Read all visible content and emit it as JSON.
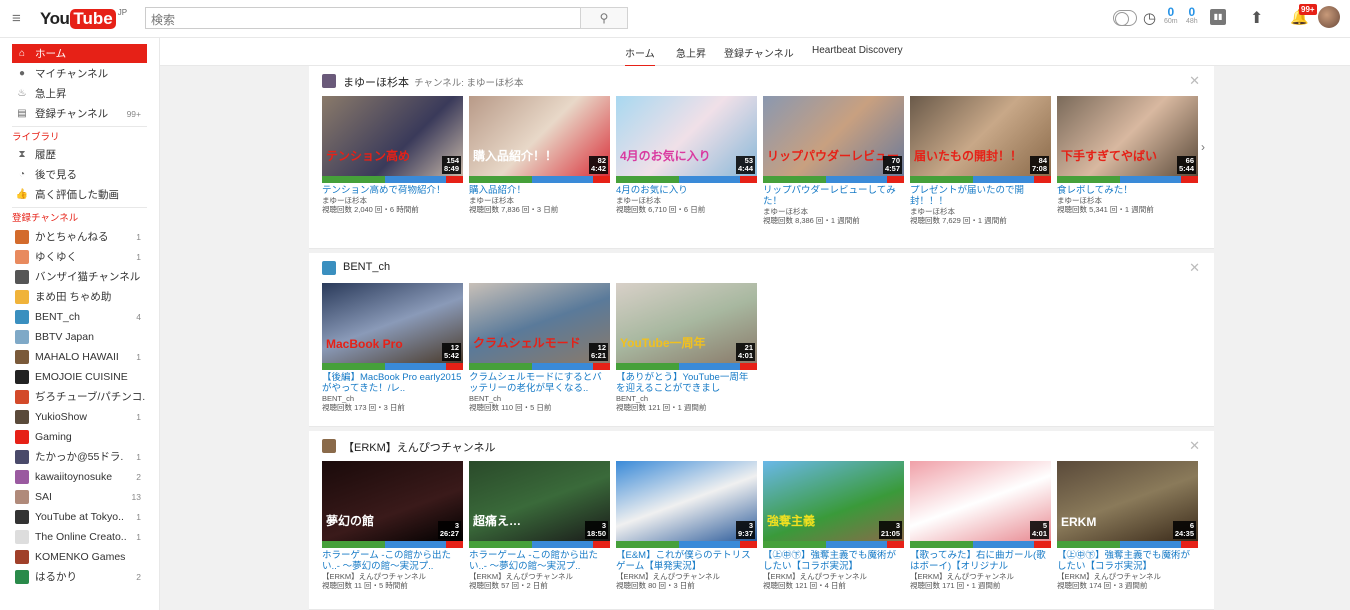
{
  "header": {
    "logo_you": "You",
    "logo_tube": "Tube",
    "logo_region": "JP",
    "search_placeholder": "検索",
    "search_icon": "search-icon",
    "count1": "0",
    "count1_sub": "60m",
    "count2": "0",
    "count2_sub": "48h",
    "notif_badge": "99+"
  },
  "sidebar": {
    "main": [
      {
        "label": "ホーム",
        "icon": "home-icon",
        "active": true
      },
      {
        "label": "マイチャンネル",
        "icon": "person-icon"
      },
      {
        "label": "急上昇",
        "icon": "flame-icon"
      },
      {
        "label": "登録チャンネル",
        "icon": "subscriptions-icon",
        "count": "99+"
      }
    ],
    "library_heading": "ライブラリ",
    "library": [
      {
        "label": "履歴",
        "icon": "hourglass-icon"
      },
      {
        "label": "後で見る",
        "icon": "clock-icon"
      },
      {
        "label": "高く評価した動画",
        "icon": "thumbs-up-icon"
      }
    ],
    "subs_heading": "登録チャンネル",
    "subs": [
      {
        "label": "かとちゃんねる",
        "count": "1",
        "color": "#d36b2c"
      },
      {
        "label": "ゆくゆく",
        "count": "1",
        "color": "#e88a5e"
      },
      {
        "label": "バンザイ猫チャンネル",
        "count": "",
        "color": "#555"
      },
      {
        "label": "まめ田 ちゃめ助",
        "count": "",
        "color": "#f0b33a"
      },
      {
        "label": "BENT_ch",
        "count": "4",
        "color": "#3a8fbf"
      },
      {
        "label": "BBTV Japan",
        "count": "",
        "color": "#7fa9c7"
      },
      {
        "label": "MAHALO HAWAII",
        "count": "1",
        "color": "#7a5a3a"
      },
      {
        "label": "EMOJOIE CUISINE",
        "count": "",
        "color": "#222"
      },
      {
        "label": "ぢろチューブ/パチンコ.",
        "count": "",
        "color": "#d34a2a"
      },
      {
        "label": "YukioShow",
        "count": "1",
        "color": "#5a4a3a"
      },
      {
        "label": "Gaming",
        "count": "",
        "color": "#e62117"
      },
      {
        "label": "たかっか@55ドラ.",
        "count": "1",
        "color": "#4a4a6a"
      },
      {
        "label": "kawaiitoynosuke",
        "count": "2",
        "color": "#9a5aa0"
      },
      {
        "label": "SAI",
        "count": "13",
        "color": "#b08a7a"
      },
      {
        "label": "YouTube at Tokyo..",
        "count": "1",
        "color": "#333"
      },
      {
        "label": "The Online Creato..",
        "count": "1",
        "color": "#ddd"
      },
      {
        "label": "KOMENKO Games",
        "count": "",
        "color": "#a0402a"
      },
      {
        "label": "はるかり",
        "count": "2",
        "color": "#2a8a4a"
      }
    ]
  },
  "nav": {
    "tabs": [
      "ホーム",
      "急上昇",
      "登録チャンネル",
      "Heartbeat Discovery"
    ]
  },
  "sections": [
    {
      "title": "まゆーほ杉本",
      "sub": "チャンネル: まゆーほ杉本",
      "avatar": "#6a5a7a",
      "videos": [
        {
          "title": "テンション高めで荷物紹介！",
          "channel": "まゆーほ杉本",
          "meta": "視聴回数 2,040 回・6 時間前",
          "count": "154",
          "duration": "8:49",
          "bg": "linear-gradient(135deg,#8a7a6a,#3a3a5a 60%,#c8b8a8)",
          "cap": "テンション高め",
          "capc": "#e62117"
        },
        {
          "title": "購入品紹介！",
          "channel": "まゆーほ杉本",
          "meta": "視聴回数 7,836 回・3 日前",
          "count": "82",
          "duration": "4:42",
          "bg": "linear-gradient(135deg,#b89a88,#e8d8c8 50%,#d9303a)",
          "cap": "購入品紹介！！",
          "capc": "#fff"
        },
        {
          "title": "4月のお気に入り",
          "channel": "まゆーほ杉本",
          "meta": "視聴回数 6,710 回・6 日前",
          "count": "53",
          "duration": "4:44",
          "bg": "linear-gradient(135deg,#a8d8f0,#f0e0e8 50%,#88b8d8)",
          "cap": "4月のお気に入り",
          "capc": "#d93aa0"
        },
        {
          "title": "リップパウダーレビューしてみた！",
          "channel": "まゆーほ杉本",
          "meta": "視聴回数 8,386 回・1 週間前",
          "count": "70",
          "duration": "4:57",
          "bg": "linear-gradient(135deg,#8a98b0,#c8a080 50%,#6a7a9a)",
          "cap": "リップパウダーレビュー",
          "capc": "#e62117"
        },
        {
          "title": "プレゼントが届いたので開封！！！",
          "channel": "まゆーほ杉本",
          "meta": "視聴回数 7,629 回・1 週間前",
          "count": "84",
          "duration": "7:08",
          "bg": "linear-gradient(135deg,#6a5a4a,#c8a888 50%,#8a6a4a)",
          "cap": "届いたもの開封！！",
          "capc": "#e62117"
        },
        {
          "title": "食レポしてみた！",
          "channel": "まゆーほ杉本",
          "meta": "視聴回数 5,341 回・1 週間前",
          "count": "66",
          "duration": "5:44",
          "bg": "linear-gradient(135deg,#7a6a5a,#d8b8a0 50%,#5a4a3a)",
          "cap": "下手すぎてやばい",
          "capc": "#e62117"
        }
      ]
    },
    {
      "title": "BENT_ch",
      "sub": "",
      "avatar": "#3a8fbf",
      "videos": [
        {
          "title": "【後編】MacBook Pro early2015がやってきた！/レ..",
          "channel": "BENT_ch",
          "meta": "視聴回数 173 回・3 日前",
          "count": "12",
          "duration": "5:42",
          "bg": "linear-gradient(160deg,#2a3a5a,#8a9ab8 50%,#4a3a2a)",
          "cap": "MacBook Pro",
          "capc": "#e62117"
        },
        {
          "title": "クラムシェルモードにするとバッテリーの老化が早くなる..",
          "channel": "BENT_ch",
          "meta": "視聴回数 110 回・5 日前",
          "count": "12",
          "duration": "6:21",
          "bg": "linear-gradient(160deg,#c8c0b8,#5a7a9a 50%,#8a7a6a)",
          "cap": "クラムシェルモード",
          "capc": "#e62117"
        },
        {
          "title": "【ありがとう】YouTube一周年を迎えることができまし",
          "channel": "BENT_ch",
          "meta": "視聴回数 121 回・1 週間前",
          "count": "21",
          "duration": "4:01",
          "bg": "linear-gradient(160deg,#d8d0c8,#a8b8a0 50%,#8a7a6a)",
          "cap": "YouTube一周年",
          "capc": "#f0c020"
        }
      ]
    },
    {
      "title": "【ERKM】えんぴつチャンネル",
      "sub": "",
      "avatar": "#8a6a4a",
      "videos": [
        {
          "title": "ホラーゲーム -この館から出たい..- ～夢幻の館～実況プ..",
          "channel": "【ERKM】えんぴつチャンネル",
          "meta": "視聴回数 11 回・5 時間前",
          "count": "3",
          "duration": "26:27",
          "bg": "linear-gradient(160deg,#1a0a0a,#3a1a1a 60%,#000)",
          "cap": "夢幻の館",
          "capc": "#fff"
        },
        {
          "title": "ホラーゲーム -この館から出たい..- ～夢幻の館～実況プ..",
          "channel": "【ERKM】えんぴつチャンネル",
          "meta": "視聴回数 57 回・2 日前",
          "count": "3",
          "duration": "18:50",
          "bg": "linear-gradient(160deg,#2a4a2a,#3a6a3a 50%,#1a1a1a)",
          "cap": "超痛え…",
          "capc": "#fff"
        },
        {
          "title": "【E&M】これが僕らのテトリスゲーム【単発実況】",
          "channel": "【ERKM】えんぴつチャンネル",
          "meta": "視聴回数 80 回・3 日前",
          "count": "3",
          "duration": "9:37",
          "bg": "linear-gradient(160deg,#3a8ad8,#f0f0f0 50%,#2a5a9a)",
          "cap": "",
          "capc": "#fff"
        },
        {
          "title": "【㊤㊥㊦】強奪主義でも魔術がしたい【コラボ実況】",
          "channel": "【ERKM】えんぴつチャンネル",
          "meta": "視聴回数 121 回・4 日前",
          "count": "3",
          "duration": "21:05",
          "bg": "linear-gradient(160deg,#6ab8e8,#3a9a3a 60%,#8a6a4a)",
          "cap": "強奪主義",
          "capc": "#f0e020"
        },
        {
          "title": "【歌ってみた】右に曲ガール(歌はボーイ)【オリジナル",
          "channel": "【ERKM】えんぴつチャンネル",
          "meta": "視聴回数 171 回・1 週間前",
          "count": "5",
          "duration": "4:01",
          "bg": "linear-gradient(160deg,#f0a0a8,#fff 50%,#e88890)",
          "cap": "",
          "capc": "#333"
        },
        {
          "title": "【㊤㊥㊦】強奪主義でも魔術がしたい【コラボ実況】",
          "channel": "【ERKM】えんぴつチャンネル",
          "meta": "視聴回数 174 回・3 週間前",
          "count": "6",
          "duration": "24:35",
          "bg": "linear-gradient(160deg,#5a4a3a,#8a7a5a 50%,#3a2a1a)",
          "cap": "ERKM",
          "capc": "#fff"
        }
      ]
    }
  ]
}
